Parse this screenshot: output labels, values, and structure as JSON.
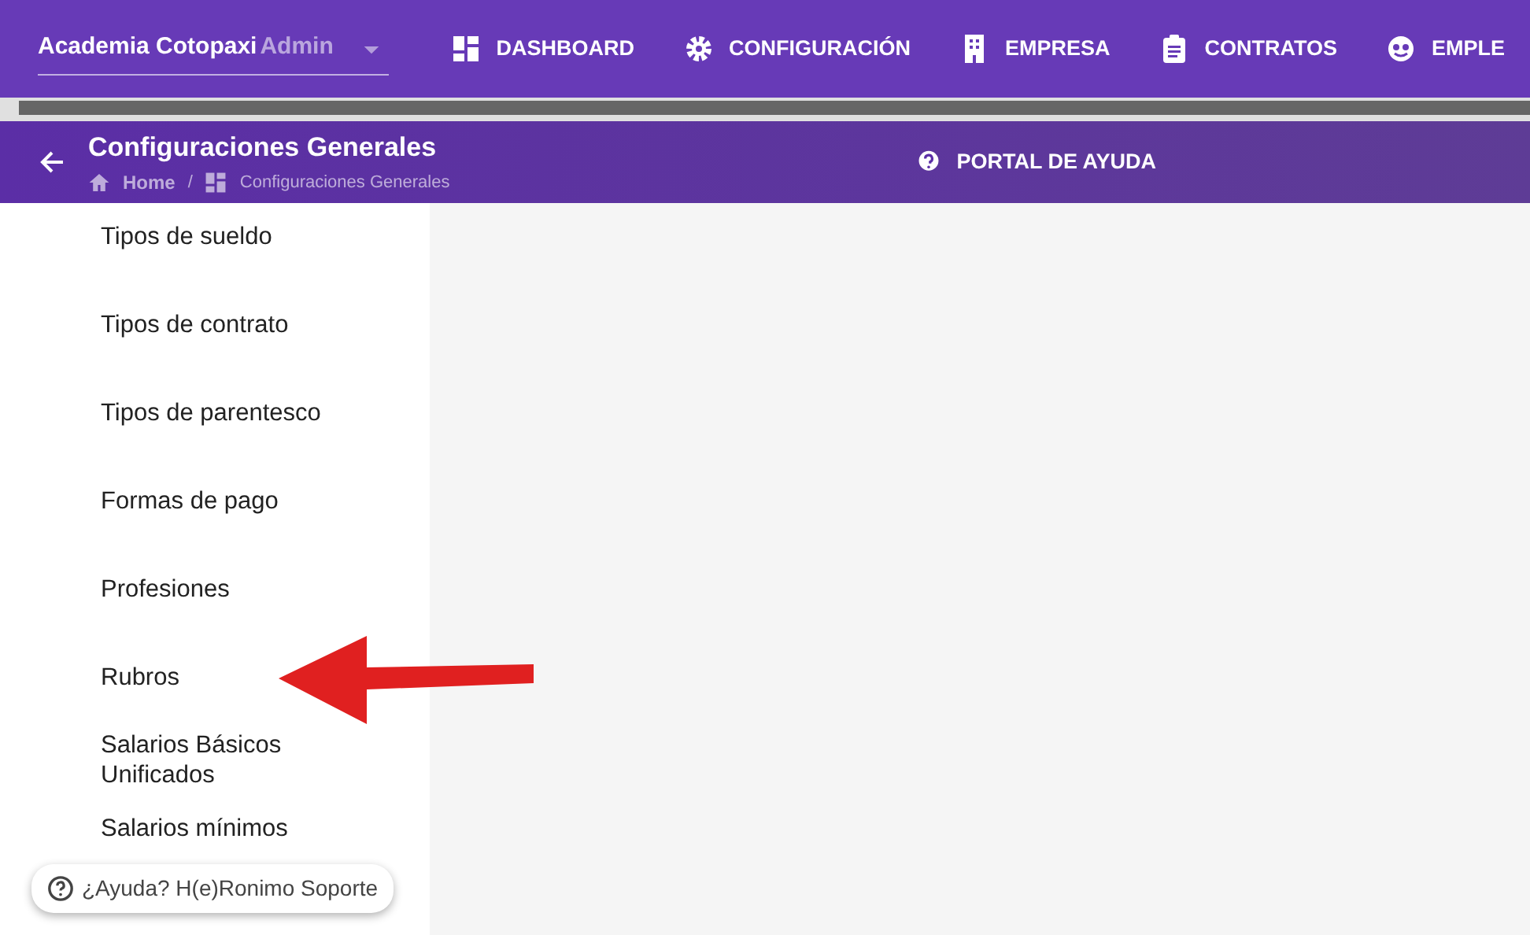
{
  "company_select": {
    "value": "Academia Cotopaxi",
    "label": "Admin"
  },
  "nav": [
    {
      "kind": "dashboard",
      "label": "DASHBOARD"
    },
    {
      "kind": "gear",
      "label": "CONFIGURACIÓN"
    },
    {
      "kind": "building",
      "label": "EMPRESA"
    },
    {
      "kind": "clipboard",
      "label": "CONTRATOS"
    },
    {
      "kind": "people",
      "label": "EMPLE"
    }
  ],
  "page_header": {
    "title": "Configuraciones Generales",
    "breadcrumb": [
      "Home",
      "Configuraciones Generales"
    ],
    "breadcrumb_separator": "/",
    "help_link": "PORTAL DE AYUDA"
  },
  "sidebar": {
    "items": [
      "Tipos de sueldo",
      "Tipos de contrato",
      "Tipos de parentesco",
      "Formas de pago",
      "Profesiones",
      "Rubros",
      "Salarios Básicos Unificados",
      "Salarios mínimos"
    ]
  },
  "help_button": "¿Ayuda? H(e)Ronimo Soporte"
}
